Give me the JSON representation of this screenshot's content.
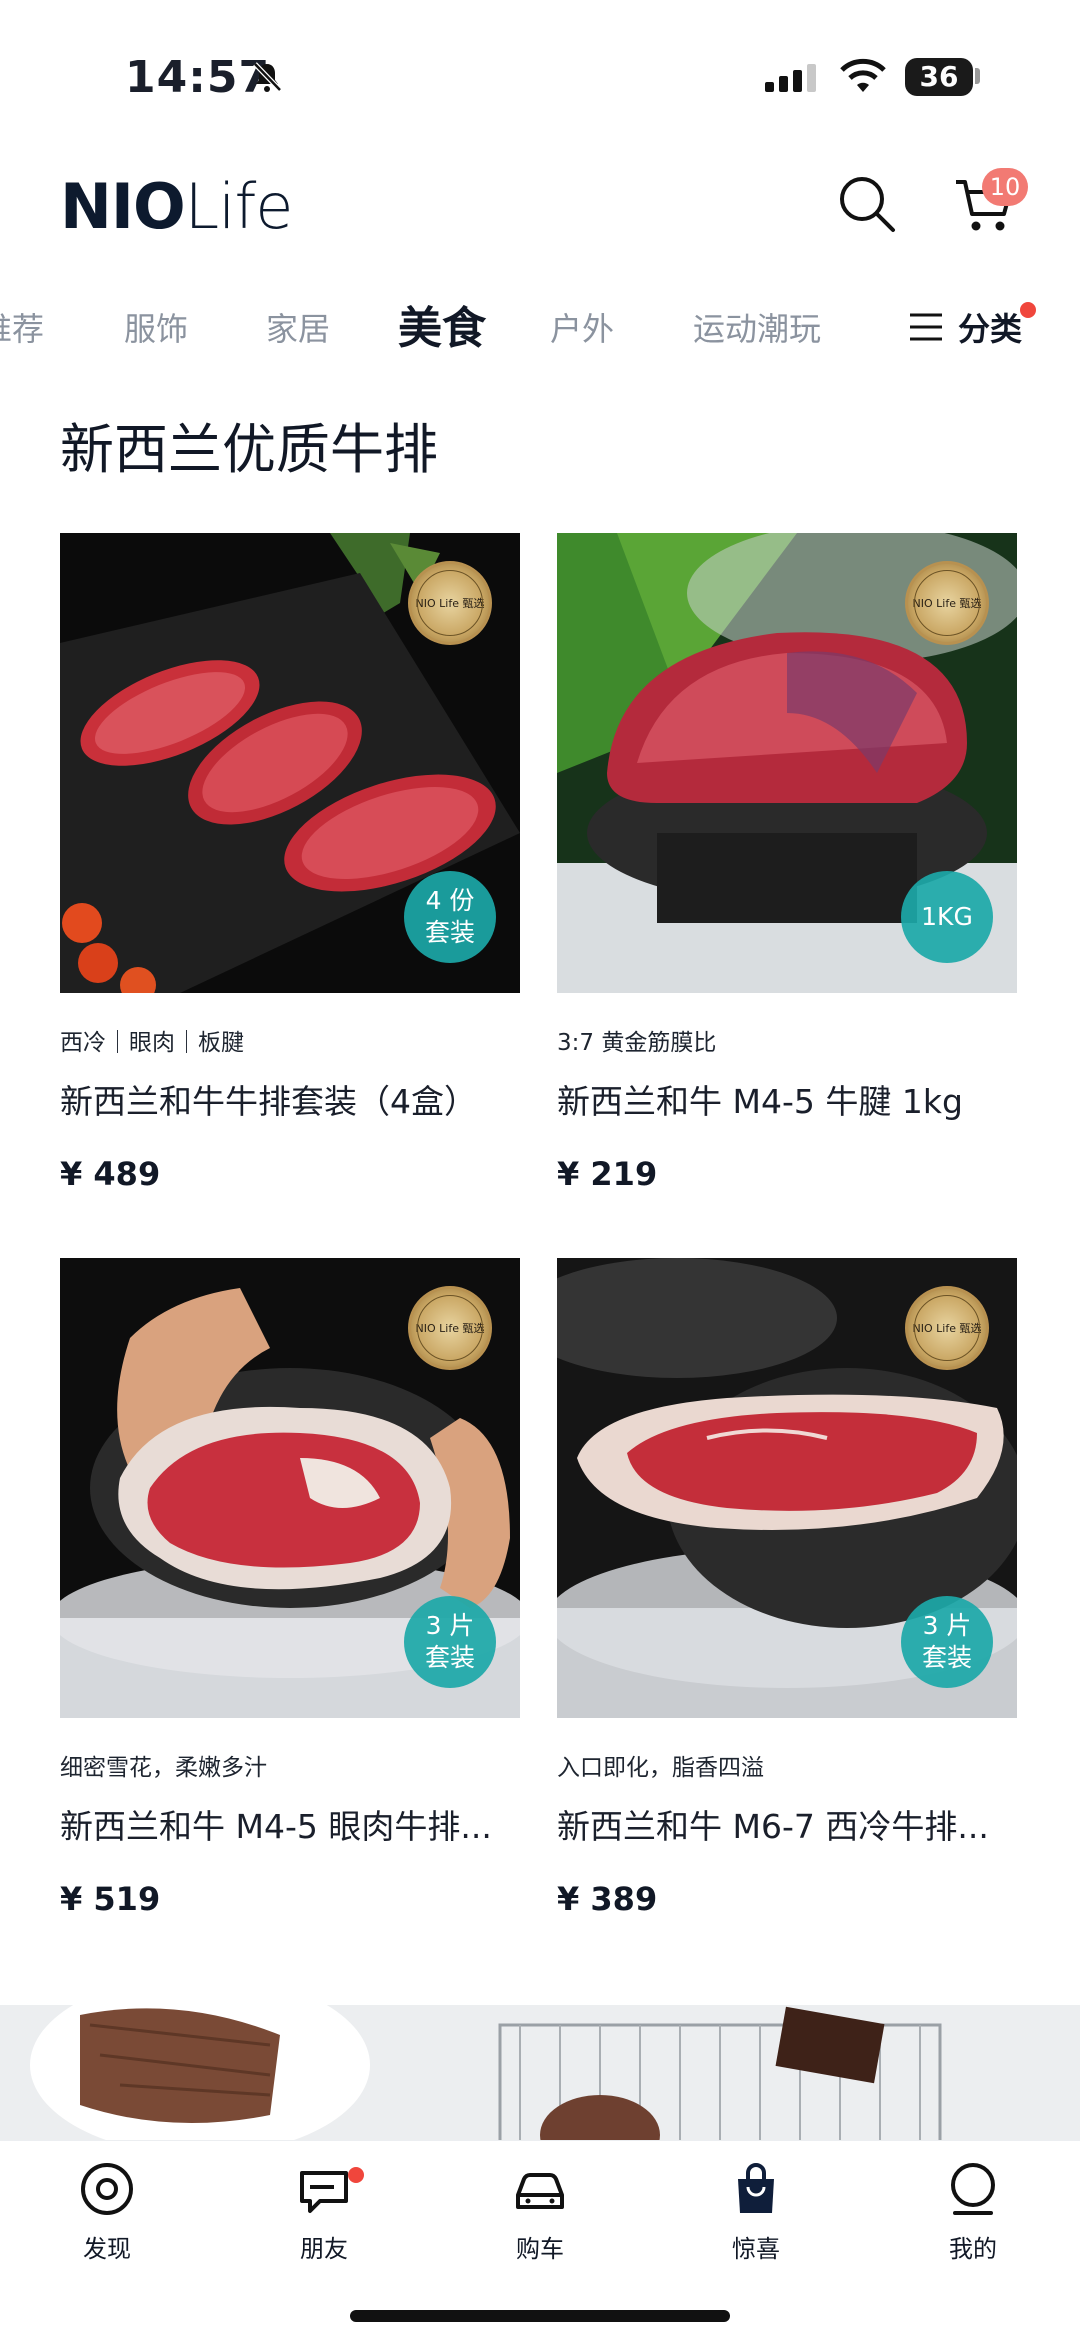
{
  "status_bar": {
    "time": "14:57",
    "battery": "36"
  },
  "header": {
    "logo_bold": "NIO",
    "logo_light": "Life",
    "cart_count": "10"
  },
  "tabs": [
    {
      "label": "推荐"
    },
    {
      "label": "服饰"
    },
    {
      "label": "家居"
    },
    {
      "label": "美食",
      "active": true
    },
    {
      "label": "户外"
    },
    {
      "label": "运动潮玩"
    }
  ],
  "category_button": {
    "label": "分类"
  },
  "section": {
    "title": "新西兰优质牛排"
  },
  "products": [
    {
      "tags": "西冷｜眼肉｜板腱",
      "name": "新西兰和牛牛排套装（4盒）",
      "price": "¥ 489",
      "badge_top": "4 份",
      "badge_bottom": "套装",
      "seal_text": "NIO Life 甄选"
    },
    {
      "tags": "3:7 黄金筋膜比",
      "name": "新西兰和牛 M4-5 牛腱 1kg",
      "price": "¥ 219",
      "badge_top": "1KG",
      "badge_bottom": "",
      "seal_text": "NIO Life 甄选"
    },
    {
      "tags": "细密雪花，柔嫩多汁",
      "name": "新西兰和牛 M4-5 眼肉牛排...",
      "price": "¥ 519",
      "badge_top": "3 片",
      "badge_bottom": "套装",
      "seal_text": "NIO Life 甄选"
    },
    {
      "tags": "入口即化，脂香四溢",
      "name": "新西兰和牛 M6-7 西冷牛排...",
      "price": "¥ 389",
      "badge_top": "3 片",
      "badge_bottom": "套装",
      "seal_text": "NIO Life 甄选"
    }
  ],
  "bottom_nav": [
    {
      "label": "发现",
      "icon": "target-icon"
    },
    {
      "label": "朋友",
      "icon": "chat-icon"
    },
    {
      "label": "购车",
      "icon": "car-icon"
    },
    {
      "label": "惊喜",
      "icon": "bag-icon",
      "active": true
    },
    {
      "label": "我的",
      "icon": "profile-icon"
    }
  ],
  "colors": {
    "accent_badge": "#1ca8a8",
    "notify_red": "#f0463c",
    "text_dark": "#111826",
    "tab_grey": "#8b939f"
  }
}
